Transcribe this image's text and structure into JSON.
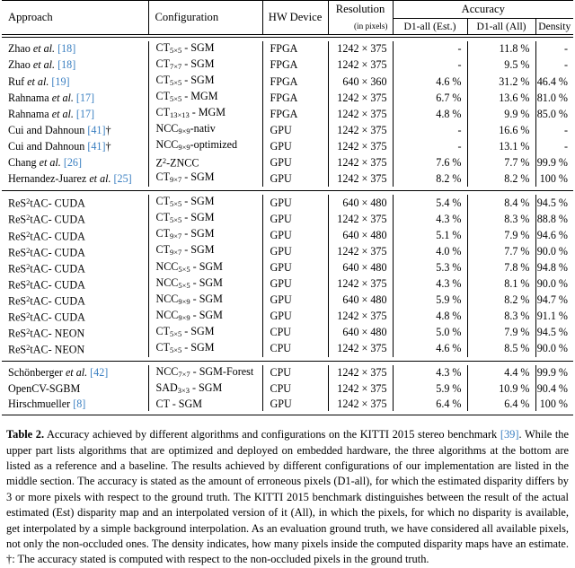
{
  "table": {
    "headers": {
      "approach": "Approach",
      "configuration": "Configuration",
      "hw_device": "HW Device",
      "resolution": "Resolution",
      "resolution_sub": "(in pixels)",
      "accuracy": "Accuracy",
      "d1_est": "D1-all (Est.)",
      "d1_all": "D1-all (All)",
      "density": "Density"
    },
    "sections": [
      {
        "name": "embedded-hardware",
        "rows": [
          {
            "approach_name": "Zhao",
            "approach_etal": "et al.",
            "approach_cite": "[18]",
            "approach_dagger": "",
            "config_base": "CT",
            "config_sub": "5×5",
            "config_rest": " - SGM",
            "device": "FPGA",
            "resolution": "1242 × 375",
            "d1_est": "-",
            "d1_all": "11.8 %",
            "density": "-",
            "bold_est": false,
            "bold_all": false,
            "bold_density": false
          },
          {
            "approach_name": "Zhao",
            "approach_etal": "et al.",
            "approach_cite": "[18]",
            "approach_dagger": "",
            "config_base": "CT",
            "config_sub": "7×7",
            "config_rest": " - SGM",
            "device": "FPGA",
            "resolution": "1242 × 375",
            "d1_est": "-",
            "d1_all": "9.5 %",
            "density": "-",
            "bold_est": false,
            "bold_all": false,
            "bold_density": false
          },
          {
            "approach_name": "Ruf",
            "approach_etal": "et al.",
            "approach_cite": "[19]",
            "approach_dagger": "",
            "config_base": "CT",
            "config_sub": "5×5",
            "config_rest": " - SGM",
            "device": "FPGA",
            "resolution": "640 × 360",
            "d1_est": "4.6 %",
            "d1_all": "31.2 %",
            "density": "46.4 %",
            "bold_est": false,
            "bold_all": false,
            "bold_density": false
          },
          {
            "approach_name": "Rahnama",
            "approach_etal": "et al.",
            "approach_cite": "[17]",
            "approach_dagger": "",
            "config_base": "CT",
            "config_sub": "5×5",
            "config_rest": " - MGM",
            "device": "FPGA",
            "resolution": "1242 × 375",
            "d1_est": "6.7 %",
            "d1_all": "13.6 %",
            "density": "81.0 %",
            "bold_est": false,
            "bold_all": false,
            "bold_density": false
          },
          {
            "approach_name": "Rahnama",
            "approach_etal": "et al.",
            "approach_cite": "[17]",
            "approach_dagger": "",
            "config_base": "CT",
            "config_sub": "13×13",
            "config_rest": " - MGM",
            "device": "FPGA",
            "resolution": "1242 × 375",
            "d1_est": "4.8 %",
            "d1_all": "9.9 %",
            "density": "85.0 %",
            "bold_est": false,
            "bold_all": false,
            "bold_density": false
          },
          {
            "approach_name": "Cui and Dahnoun",
            "approach_etal": "",
            "approach_cite": "[41]",
            "approach_dagger": "†",
            "config_base": "NCC",
            "config_sub": "9×9",
            "config_rest": "-nativ",
            "device": "GPU",
            "resolution": "1242 × 375",
            "d1_est": "-",
            "d1_all": "16.6 %",
            "density": "-",
            "bold_est": false,
            "bold_all": false,
            "bold_density": false
          },
          {
            "approach_name": "Cui and Dahnoun",
            "approach_etal": "",
            "approach_cite": "[41]",
            "approach_dagger": "†",
            "config_base": "NCC",
            "config_sub": "9×9",
            "config_rest": "-optimized",
            "device": "GPU",
            "resolution": "1242 × 375",
            "d1_est": "-",
            "d1_all": "13.1 %",
            "density": "-",
            "bold_est": false,
            "bold_all": false,
            "bold_density": false
          },
          {
            "approach_name": "Chang",
            "approach_etal": "et al.",
            "approach_cite": "[26]",
            "approach_dagger": "",
            "config_base": "Z",
            "config_sup": "2",
            "config_rest": "-ZNCC",
            "device": "GPU",
            "resolution": "1242 × 375",
            "d1_est": "7.6 %",
            "d1_all": "7.7 %",
            "density": "99.9 %",
            "bold_est": false,
            "bold_all": false,
            "bold_density": false
          },
          {
            "approach_name": "Hernandez-Juarez",
            "approach_etal": "et al.",
            "approach_cite": "[25]",
            "approach_dagger": "",
            "config_base": "CT",
            "config_sub": "9×7",
            "config_rest": " - SGM",
            "device": "GPU",
            "resolution": "1242 × 375",
            "d1_est": "8.2 %",
            "d1_all": "8.2 %",
            "density": "100 %",
            "bold_est": false,
            "bold_all": false,
            "bold_density": true
          }
        ]
      },
      {
        "name": "our-implementation",
        "rows": [
          {
            "approach_base": "ReS",
            "approach_sup": "2",
            "approach_rest": "tAC- CUDA",
            "config_base": "CT",
            "config_sub": "5×5",
            "config_rest": " - SGM",
            "device": "GPU",
            "resolution": "640 × 480",
            "d1_est": "5.4 %",
            "d1_all": "8.4 %",
            "density": "94.5 %",
            "bold_est": false,
            "bold_all": false,
            "bold_density": false
          },
          {
            "approach_base": "ReS",
            "approach_sup": "2",
            "approach_rest": "tAC- CUDA",
            "config_base": "CT",
            "config_sub": "5×5",
            "config_rest": " - SGM",
            "device": "GPU",
            "resolution": "1242 × 375",
            "d1_est": "4.3 %",
            "d1_all": "8.3 %",
            "density": "88.8 %",
            "bold_est": false,
            "bold_all": false,
            "bold_density": false
          },
          {
            "approach_base": "ReS",
            "approach_sup": "2",
            "approach_rest": "tAC- CUDA",
            "config_base": "CT",
            "config_sub": "9×7",
            "config_rest": " - SGM",
            "device": "GPU",
            "resolution": "640 × 480",
            "d1_est": "5.1 %",
            "d1_all": "7.9 %",
            "density": "94.6 %",
            "bold_est": false,
            "bold_all": false,
            "bold_density": false
          },
          {
            "approach_base": "ReS",
            "approach_sup": "2",
            "approach_rest": "tAC- CUDA",
            "config_base": "CT",
            "config_sub": "9×7",
            "config_rest": " - SGM",
            "device": "GPU",
            "resolution": "1242 × 375",
            "d1_est": "4.0 %",
            "d1_all": "7.7 %",
            "density": "90.0 %",
            "bold_est": true,
            "bold_all": false,
            "bold_density": false
          },
          {
            "approach_base": "ReS",
            "approach_sup": "2",
            "approach_rest": "tAC- CUDA",
            "config_base": "NCC",
            "config_sub": "5×5",
            "config_rest": " - SGM",
            "device": "GPU",
            "resolution": "640 × 480",
            "d1_est": "5.3 %",
            "d1_all": "7.8 %",
            "density": "94.8 %",
            "bold_est": false,
            "bold_all": false,
            "bold_density": false
          },
          {
            "approach_base": "ReS",
            "approach_sup": "2",
            "approach_rest": "tAC- CUDA",
            "config_base": "NCC",
            "config_sub": "5×5",
            "config_rest": " - SGM",
            "device": "GPU",
            "resolution": "1242 × 375",
            "d1_est": "4.3 %",
            "d1_all": "8.1 %",
            "density": "90.0 %",
            "bold_est": false,
            "bold_all": false,
            "bold_density": false
          },
          {
            "approach_base": "ReS",
            "approach_sup": "2",
            "approach_rest": "tAC- CUDA",
            "config_base": "NCC",
            "config_sub": "9×9",
            "config_rest": " - SGM",
            "device": "GPU",
            "resolution": "640 × 480",
            "d1_est": "5.9 %",
            "d1_all": "8.2 %",
            "density": "94.7 %",
            "bold_est": false,
            "bold_all": false,
            "bold_density": false
          },
          {
            "approach_base": "ReS",
            "approach_sup": "2",
            "approach_rest": "tAC- CUDA",
            "config_base": "NCC",
            "config_sub": "9×9",
            "config_rest": " - SGM",
            "device": "GPU",
            "resolution": "1242 × 375",
            "d1_est": "4.8 %",
            "d1_all": "8.3 %",
            "density": "91.1 %",
            "bold_est": false,
            "bold_all": false,
            "bold_density": false
          },
          {
            "approach_base": "ReS",
            "approach_sup": "2",
            "approach_rest": "tAC- NEON",
            "config_base": "CT",
            "config_sub": "5×5",
            "config_rest": " - SGM",
            "device": "CPU",
            "resolution": "640 × 480",
            "d1_est": "5.0 %",
            "d1_all": "7.9 %",
            "density": "94.5 %",
            "bold_est": false,
            "bold_all": false,
            "bold_density": false
          },
          {
            "approach_base": "ReS",
            "approach_sup": "2",
            "approach_rest": "tAC- NEON",
            "config_base": "CT",
            "config_sub": "5×5",
            "config_rest": " - SGM",
            "device": "CPU",
            "resolution": "1242 × 375",
            "d1_est": "4.6 %",
            "d1_all": "8.5 %",
            "density": "90.0 %",
            "bold_est": false,
            "bold_all": false,
            "bold_density": false
          }
        ]
      },
      {
        "name": "reference-baseline",
        "rows": [
          {
            "approach_name": "Schönberger",
            "approach_etal": "et al.",
            "approach_cite": "[42]",
            "approach_dagger": "",
            "config_base": "NCC",
            "config_sub": "7×7",
            "config_rest": " - SGM-Forest",
            "device": "CPU",
            "resolution": "1242 × 375",
            "d1_est": "4.3 %",
            "d1_all": "4.4 %",
            "density": "99.9 %",
            "bold_est": false,
            "bold_all": true,
            "bold_density": false
          },
          {
            "approach_name": "OpenCV-SGBM",
            "approach_etal": "",
            "approach_cite": "",
            "approach_dagger": "",
            "config_base": "SAD",
            "config_sub": "3×3",
            "config_rest": " - SGM",
            "device": "CPU",
            "resolution": "1242 × 375",
            "d1_est": "5.9 %",
            "d1_all": "10.9 %",
            "density": "90.4 %",
            "bold_est": false,
            "bold_all": false,
            "bold_density": false
          },
          {
            "approach_name": "Hirschmueller",
            "approach_etal": "",
            "approach_cite": "[8]",
            "approach_dagger": "",
            "config_base": "CT",
            "config_sub": "",
            "config_rest": " - SGM",
            "device": "GPU",
            "resolution": "1242 × 375",
            "d1_est": "6.4 %",
            "d1_all": "6.4 %",
            "density": "100 %",
            "bold_est": false,
            "bold_all": false,
            "bold_density": true
          }
        ]
      }
    ]
  },
  "caption": {
    "label": "Table 2.",
    "part1": " Accuracy achieved by different algorithms and configurations on the KITTI 2015 stereo benchmark ",
    "cite1": "[39]",
    "part2": ". While the upper part lists algorithms that are optimized and deployed on embedded hardware, the three algorithms at the bottom are listed as a reference and a baseline. The results achieved by different configurations of our implementation are listed in the middle section. The accuracy is stated as the amount of erroneous pixels (D1-all), for which the estimated disparity differs by 3 or more pixels with respect to the ground truth. The KITTI 2015 benchmark distinguishes between the result of the actual estimated (Est) disparity map and an interpolated version of it (All), in which the pixels, for which no disparity is available, get interpolated by a simple background interpolation. As an evaluation ground truth, we have considered all available pixels, not only the non-occluded ones. The density indicates, how many pixels inside the computed disparity maps have an estimate. †: The accuracy stated is computed with respect to the non-occluded pixels in the ground truth."
  },
  "colors": {
    "citation_link": "#3a7fc1",
    "text": "#000000",
    "background": "#ffffff"
  }
}
